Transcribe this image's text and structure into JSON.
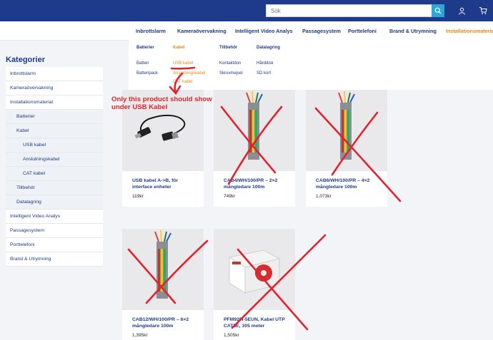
{
  "header": {
    "search_placeholder": "Sök",
    "search_icon": "search-icon",
    "user_icon": "user-icon",
    "cart_icon": "cart-icon"
  },
  "nav": {
    "items": [
      "Inbrottslarm",
      "Kameraövervakning",
      "Intelligent Video Analys",
      "Passagesystem",
      "Porttelefoni",
      "Brand & Utrymning",
      "Installationsmaterial"
    ],
    "active_index": 6
  },
  "mega_menu": {
    "columns": [
      {
        "heading": "Batterier",
        "links": [
          "Batteri",
          "Batteripack"
        ]
      },
      {
        "heading": "Kabel",
        "links": [
          "USB kabel",
          "Anslutningskabel",
          "CAT kabel"
        ]
      },
      {
        "heading": "Tillbehör",
        "links": [
          "Kontaktdon",
          "Skruvmejsel"
        ]
      },
      {
        "heading": "Datalagring",
        "links": [
          "Hårddisk",
          "SD kort"
        ]
      }
    ]
  },
  "sidebar": {
    "title": "Kategorier",
    "items": [
      {
        "label": "Inbrottslarm",
        "level": 0
      },
      {
        "label": "Kameraövervakning",
        "level": 0
      },
      {
        "label": "Installationsmaterial",
        "level": 0
      },
      {
        "label": "Batterier",
        "level": 1
      },
      {
        "label": "Kabel",
        "level": 1
      },
      {
        "label": "USB kabel",
        "level": 2
      },
      {
        "label": "Anslutningskabel",
        "level": 2
      },
      {
        "label": "CAT kabel",
        "level": 2
      },
      {
        "label": "Tillbehör",
        "level": 1
      },
      {
        "label": "Datalagring",
        "level": 1
      },
      {
        "label": "Intelligent Video Analys",
        "level": 0
      },
      {
        "label": "Passagesystem",
        "level": 0
      },
      {
        "label": "Porttelefoni",
        "level": 0
      },
      {
        "label": "Brand & Utrymning",
        "level": 0
      }
    ]
  },
  "products": [
    {
      "title": "USB kabel A->B, för interface enheter",
      "price": "119kr",
      "image": "usb-cable",
      "crossed": false
    },
    {
      "title": "CAB4/WH/100/PR – 2×2 mångledare 100m",
      "price": "749kr",
      "image": "multicore-cable",
      "crossed": true
    },
    {
      "title": "CAB6/WH/100/PR – 4×2 mångledare 100m",
      "price": "1,073kr",
      "image": "multicore-cable",
      "crossed": true
    },
    {
      "title": "CAB12/WH/100/PR – 6×2 mångledare 100m",
      "price": "1,395kr",
      "image": "multicore-cable",
      "crossed": true
    },
    {
      "title": "PFM920I-5EUN, Kabel UTP CAT5E, 305 meter",
      "price": "1,505kr",
      "image": "cable-box",
      "crossed": true
    }
  ],
  "annotation": {
    "line1": "Only this product should show",
    "line2": "under USB Kabel",
    "color": "#e0232e"
  },
  "colors": {
    "brand": "#1e3a8a",
    "accent": "#e8891c",
    "search_button": "#2ea6d8",
    "annotation": "#e0232e"
  }
}
